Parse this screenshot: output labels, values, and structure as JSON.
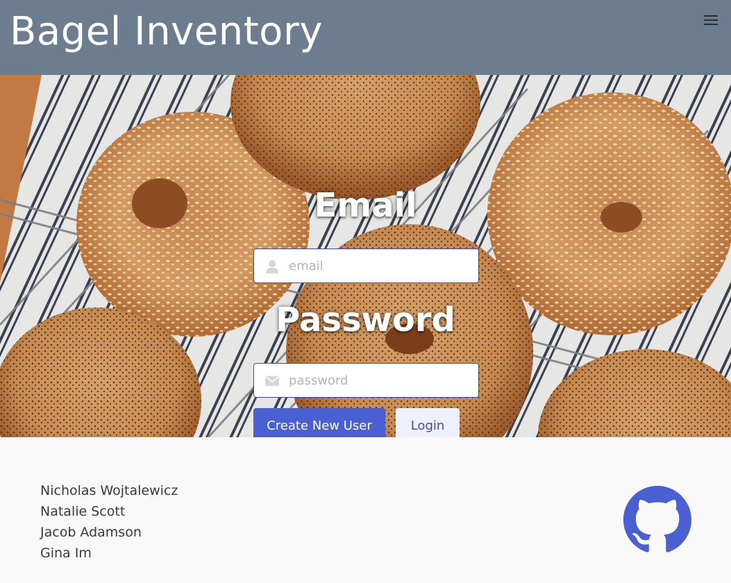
{
  "header": {
    "title": "Bagel Inventory",
    "menu_icon": "hamburger-menu-icon"
  },
  "login": {
    "email_label": "Email",
    "email_placeholder": "email",
    "email_icon": "user-icon",
    "password_label": "Password",
    "password_placeholder": "password",
    "password_icon": "envelope-icon",
    "create_button": "Create New User",
    "login_button": "Login"
  },
  "footer": {
    "names": [
      "Nicholas Wojtalewicz",
      "Natalie Scott",
      "Jacob Adamson",
      "Gina Im"
    ],
    "github_icon": "github-icon"
  },
  "colors": {
    "navbar": "#6b7d8e",
    "primary": "#4a5fd1",
    "github": "#4a5fd1",
    "input_border": "#3c4ab0"
  }
}
